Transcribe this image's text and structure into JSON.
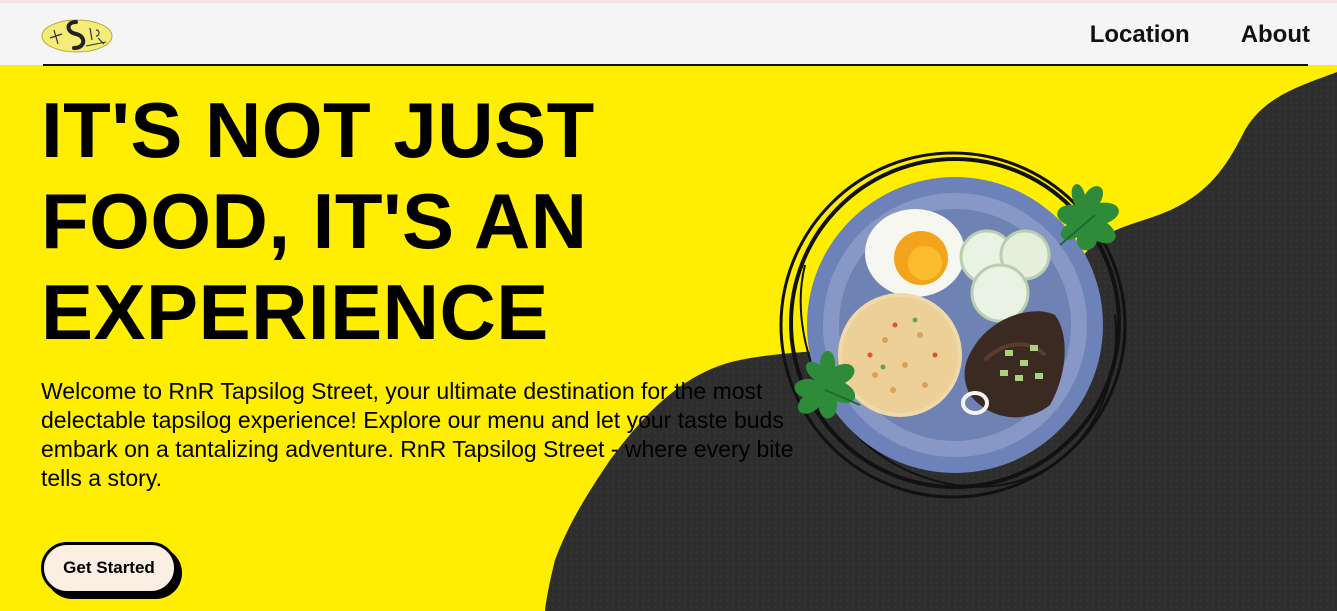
{
  "header": {
    "logo_icon": "tapsilog-street-logo",
    "nav": [
      {
        "label": "Location"
      },
      {
        "label": "About"
      }
    ]
  },
  "hero": {
    "title": "IT'S NOT JUST FOOD, IT'S AN EXPERIENCE",
    "description": "Welcome to RnR Tapsilog Street, your ultimate destination for the most delectable tapsilog experience! Explore our menu and let your taste buds embark on a tantalizing adventure. RnR Tapsilog Street - where every bite tells a story.",
    "cta_label": "Get Started",
    "image_icon": "tapsilog-plate-icon"
  },
  "colors": {
    "background": "#ffee00",
    "dark_texture": "#2f2f2f",
    "header": "#f5f5f5",
    "button_fill": "#fbeee3"
  }
}
